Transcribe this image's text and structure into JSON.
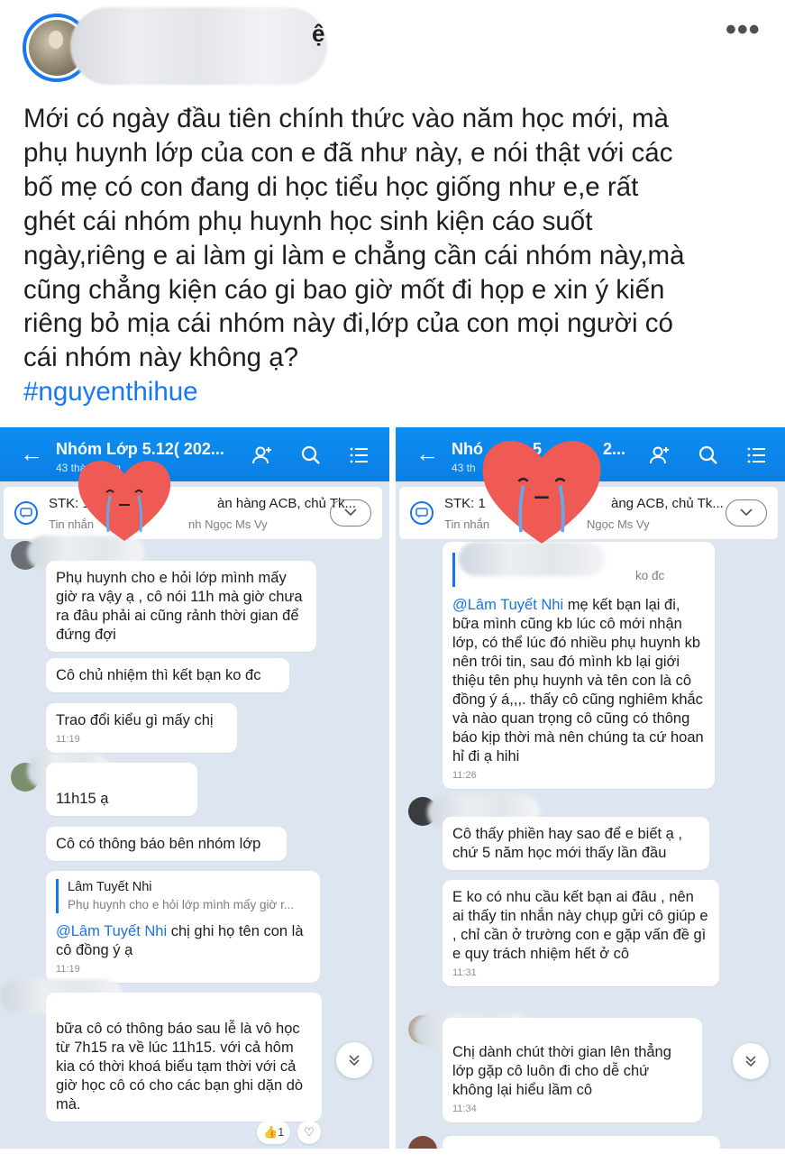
{
  "post": {
    "author_tail": "ệ",
    "more_label": "•••",
    "lines": [
      "Mới có ngày đầu tiên chính thức vào năm học mới, mà",
      "phụ huynh lớp của con e đã như này, e nói thật với các",
      "bố mẹ có con đang di học tiểu học giống như e,e rất",
      "ghét cái nhóm phụ huynh học sinh kiện cáo suốt",
      "ngày,riêng e ai làm gi làm e chẳng cần cái nhóm này,mà",
      "cũng chẳng kiện cáo gi bao giờ mốt đi họp e xin ý kiến",
      "riêng bỏ mịa cái nhóm này đi,lớp của con mọi người có",
      "cái nhóm này không ạ?"
    ],
    "hashtag": "#nguyenthihue"
  },
  "left": {
    "back": "←",
    "title": "Nhóm Lớp 5.12( 202...",
    "members": "43 thành viên",
    "pinned_line1": "STK: 1",
    "pinned_line1b": "àn hàng ACB, chủ Tk...",
    "pinned_line2": "Tin nhắn",
    "pinned_line2b": "nh Ngọc Ms Vy",
    "messages": [
      {
        "text": "Phụ huynh cho e hỏi lớp mình mấy giờ ra vậy ạ , cô nói 11h mà giờ chưa ra đâu phải ai cũng rảnh thời gian để đứng đợi"
      },
      {
        "text": "Cô chủ nhiệm thì kết bạn ko đc"
      },
      {
        "text": "Trao đổi kiểu gì mấy chị",
        "time": "11:19"
      },
      {
        "text": "11h15 ạ"
      },
      {
        "text": "Cô có thông báo bên nhóm lớp"
      },
      {
        "quote_name": "Lâm Tuyết Nhi",
        "quote_text": "Phụ huynh cho e hỏi lớp mình mấy giờ r...",
        "mention": "@Lâm Tuyết Nhi",
        "text": " chị ghi họ tên con là cô đồng ý ạ",
        "time": "11:19"
      },
      {
        "text": "bữa cô có thông báo sau lễ là vô học từ 7h15 ra về lúc 11h15. với cả hôm kia có thời khoá biểu tạm thời với cả giờ học cô có cho các bạn ghi dặn dò mà."
      }
    ],
    "reaction": "👍1",
    "heart_react": "♡"
  },
  "right": {
    "back": "←",
    "title": "Nhó",
    "title_tail": "5",
    "title_tail2": "2...",
    "members": "43 th",
    "pinned_line1": "STK: 1",
    "pinned_line1b": "àng ACB, chủ Tk...",
    "pinned_line2": "Tin nhắn",
    "pinned_line2b": "Ngọc Ms Vy",
    "messages": [
      {
        "quote_text": "ko đc",
        "mention": "@Lâm Tuyết Nhi",
        "text": " mẹ kết bạn lại đi, bữa mình cũng kb lúc cô mới nhận lớp, có thể lúc đó nhiều phụ huynh kb nên trôi tin, sau đó mình kb lại giới thiệu tên phụ huynh và tên con là cô đồng ý á,,,. thấy cô cũng nghiêm khắc và nào quan trọng cô cũng có thông báo kịp thời mà nên chúng ta cứ hoan hỉ đi ạ hihi",
        "time": "11:26"
      },
      {
        "text": "Cô thấy phiền hay sao để e biết ạ , chứ 5 năm học mới thấy lần đầu"
      },
      {
        "text": "E ko có nhu cầu kết bạn ai đâu , nên ai thấy tin nhắn này chụp gửi cô giúp e , chỉ cần ở trường con e gặp vấn đề gì e quy trách nhiệm hết ở cô",
        "time": "11:31"
      },
      {
        "text": "Chị dành chút thời gian lên thẳng lớp gặp cô luôn đi cho dễ chứ không lại hiểu lầm cô",
        "time": "11:34"
      }
    ]
  },
  "colors": {
    "accent": "#1877f2",
    "zalo_blue": "#0a7fe6",
    "chat_bg": "#dde6f0",
    "heart": "#f05a55"
  },
  "icons": [
    "more-icon",
    "back-arrow-icon",
    "add-member-icon",
    "search-icon",
    "menu-icon",
    "pinned-message-icon",
    "chevron-down-icon",
    "scroll-down-icon",
    "heart-sticker-icon"
  ]
}
